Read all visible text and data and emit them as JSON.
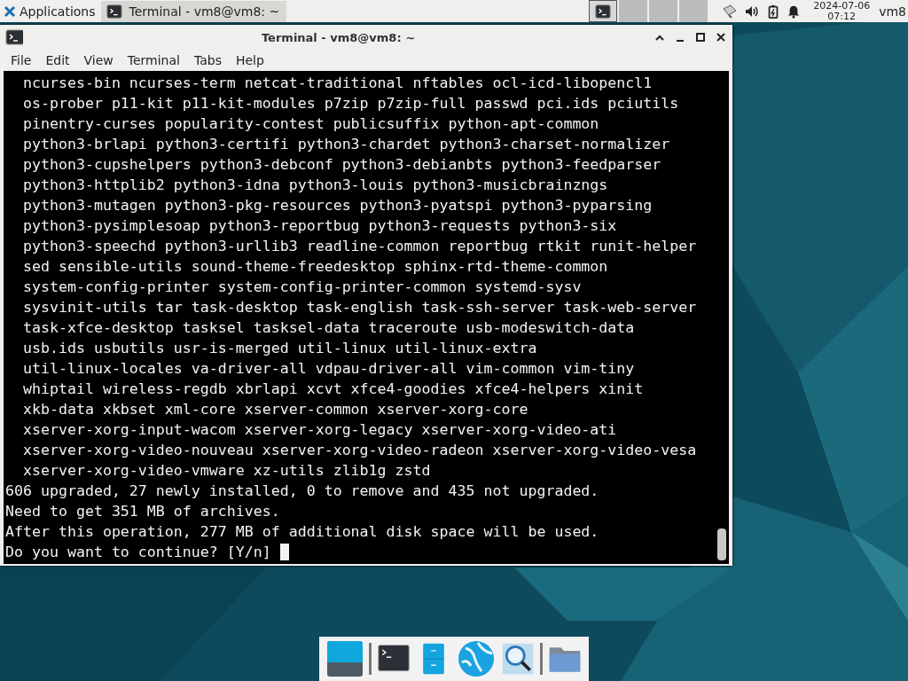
{
  "panel": {
    "applications": "Applications",
    "tasks": [
      {
        "title": "Terminal - vm8@vm8: ~",
        "selected": true
      }
    ],
    "workspaces": [
      {
        "selected": true
      },
      {
        "selected": false
      },
      {
        "selected": false
      },
      {
        "selected": false
      }
    ],
    "clock": {
      "date": "2024-07-06",
      "time": "07:12"
    },
    "user": "vm8"
  },
  "window": {
    "title": "Terminal - vm8@vm8: ~",
    "menu": [
      "File",
      "Edit",
      "View",
      "Terminal",
      "Tabs",
      "Help"
    ],
    "lines": [
      "  ncurses-bin ncurses-term netcat-traditional nftables ocl-icd-libopencl1",
      "  os-prober p11-kit p11-kit-modules p7zip p7zip-full passwd pci.ids pciutils",
      "  pinentry-curses popularity-contest publicsuffix python-apt-common",
      "  python3-brlapi python3-certifi python3-chardet python3-charset-normalizer",
      "  python3-cupshelpers python3-debconf python3-debianbts python3-feedparser",
      "  python3-httplib2 python3-idna python3-louis python3-musicbrainzngs",
      "  python3-mutagen python3-pkg-resources python3-pyatspi python3-pyparsing",
      "  python3-pysimplesoap python3-reportbug python3-requests python3-six",
      "  python3-speechd python3-urllib3 readline-common reportbug rtkit runit-helper",
      "  sed sensible-utils sound-theme-freedesktop sphinx-rtd-theme-common",
      "  system-config-printer system-config-printer-common systemd-sysv",
      "  sysvinit-utils tar task-desktop task-english task-ssh-server task-web-server",
      "  task-xfce-desktop tasksel tasksel-data traceroute usb-modeswitch-data",
      "  usb.ids usbutils usr-is-merged util-linux util-linux-extra",
      "  util-linux-locales va-driver-all vdpau-driver-all vim-common vim-tiny",
      "  whiptail wireless-regdb xbrlapi xcvt xfce4-goodies xfce4-helpers xinit",
      "  xkb-data xkbset xml-core xserver-common xserver-xorg-core",
      "  xserver-xorg-input-wacom xserver-xorg-legacy xserver-xorg-video-ati",
      "  xserver-xorg-video-nouveau xserver-xorg-video-radeon xserver-xorg-video-vesa",
      "  xserver-xorg-video-vmware xz-utils zlib1g zstd",
      "606 upgraded, 27 newly installed, 0 to remove and 435 not upgraded.",
      "Need to get 351 MB of archives.",
      "After this operation, 277 MB of additional disk space will be used.",
      "Do you want to continue? [Y/n] "
    ]
  }
}
